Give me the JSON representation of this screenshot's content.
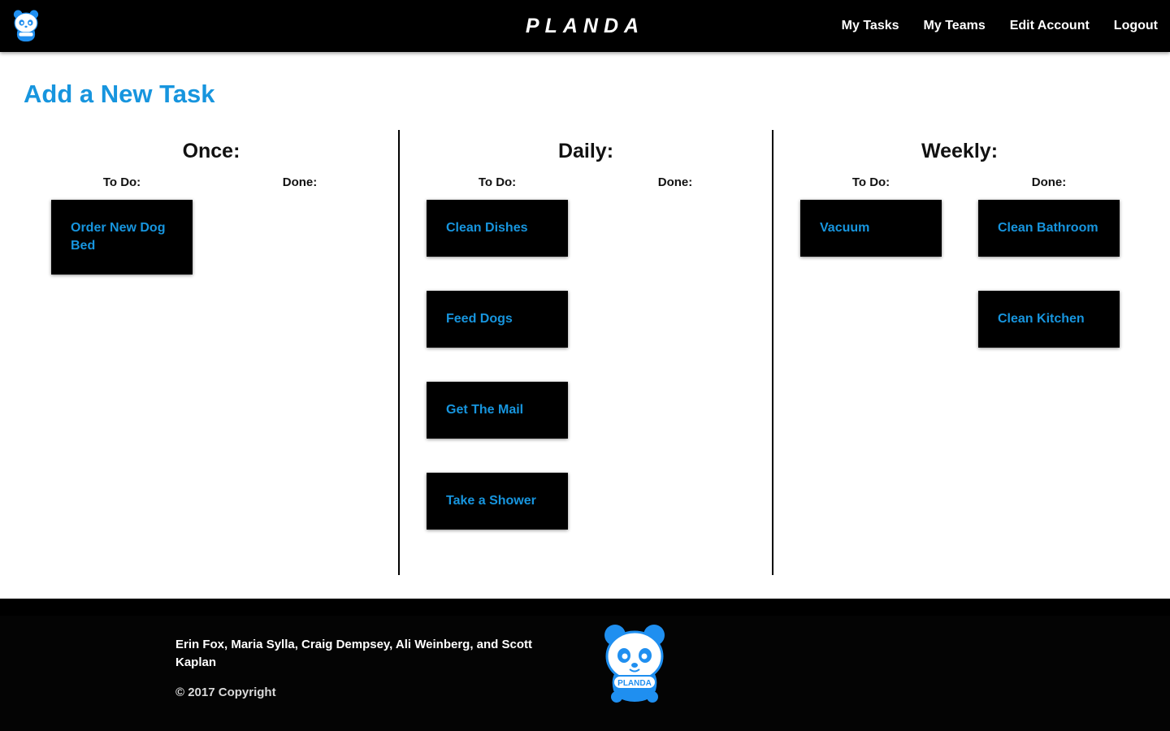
{
  "brand": {
    "name": "PLANDA",
    "accent_color": "#1795de",
    "logo_icon": "panda-icon"
  },
  "nav": {
    "items": [
      {
        "label": "My Tasks"
      },
      {
        "label": "My Teams"
      },
      {
        "label": "Edit Account"
      },
      {
        "label": "Logout"
      }
    ]
  },
  "page": {
    "title": "Add a New Task"
  },
  "columns": [
    {
      "title": "Once:",
      "todo_label": "To Do:",
      "done_label": "Done:",
      "todo": [
        "Order New Dog Bed"
      ],
      "done": []
    },
    {
      "title": "Daily:",
      "todo_label": "To Do:",
      "done_label": "Done:",
      "todo": [
        "Clean Dishes",
        "Feed Dogs",
        "Get The Mail",
        "Take a Shower"
      ],
      "done": []
    },
    {
      "title": "Weekly:",
      "todo_label": "To Do:",
      "done_label": "Done:",
      "todo": [
        "Vacuum"
      ],
      "done": [
        "Clean Bathroom",
        "Clean Kitchen"
      ]
    }
  ],
  "footer": {
    "credits": "Erin Fox, Maria Sylla, Craig Dempsey, Ali Weinberg, and Scott Kaplan",
    "copyright": "© 2017 Copyright",
    "logo_label": "PLANDA"
  }
}
